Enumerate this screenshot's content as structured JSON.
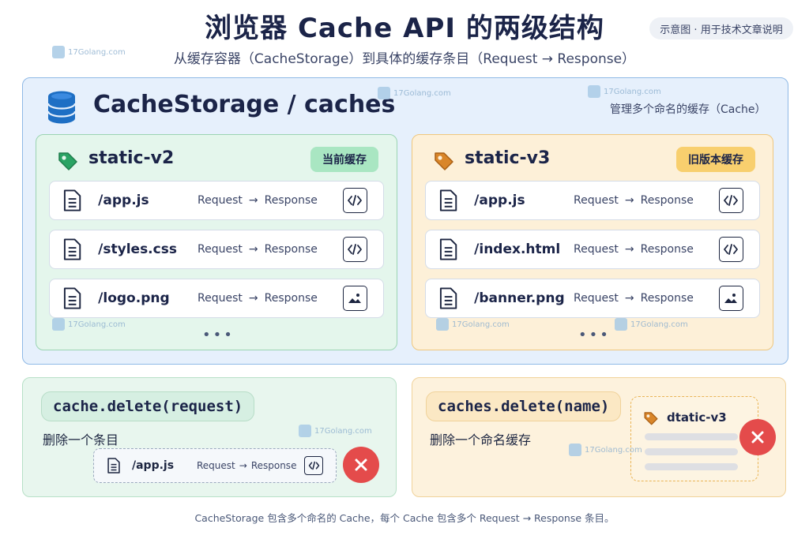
{
  "header": {
    "title": "浏览器 Cache API 的两级结构",
    "subtitle": "从缓存容器（CacheStorage）到具体的缓存条目（Request → Response）",
    "tag": "示意图 · 用于技术文章说明"
  },
  "watermark": "17Golang.com",
  "storage": {
    "title": "CacheStorage / caches",
    "note": "管理多个命名的缓存（Cache）"
  },
  "caches": [
    {
      "name": "static-v2",
      "badge": "当前缓存",
      "tag_color": "#2aa364",
      "entries": [
        {
          "path": "/app.js",
          "request": "Request",
          "arrow": "→",
          "response": "Response",
          "icon": "code-icon"
        },
        {
          "path": "/styles.css",
          "request": "Request",
          "arrow": "→",
          "response": "Response",
          "icon": "code-icon"
        },
        {
          "path": "/logo.png",
          "request": "Request",
          "arrow": "→",
          "response": "Response",
          "icon": "image-icon"
        }
      ],
      "more": "•••"
    },
    {
      "name": "static-v3",
      "badge": "旧版本缓存",
      "tag_color": "#d9862a",
      "entries": [
        {
          "path": "/app.js",
          "request": "Request",
          "arrow": "→",
          "response": "Response",
          "icon": "code-icon"
        },
        {
          "path": "/index.html",
          "request": "Request",
          "arrow": "→",
          "response": "Response",
          "icon": "code-icon"
        },
        {
          "path": "/banner.png",
          "request": "Request",
          "arrow": "→",
          "response": "Response",
          "icon": "image-icon"
        }
      ],
      "more": "•••"
    }
  ],
  "delete_entry": {
    "code": "cache.delete(request)",
    "desc": "删除一个条目",
    "entry": {
      "path": "/app.js",
      "request": "Request",
      "arrow": "→",
      "response": "Response"
    }
  },
  "delete_cache": {
    "code": "caches.delete(name)",
    "desc": "删除一个命名缓存",
    "card_name": "dtatic-v3"
  },
  "footer": "CacheStorage 包含多个命名的 Cache，每个 Cache 包含多个 Request → Response 条目。",
  "colors": {
    "storage_bg": "#e6f0fc",
    "green_panel": "#e4f6ec",
    "orange_panel": "#fdf0d8",
    "delete_red": "#e44b4b",
    "db_blue": "#1e6fc4"
  }
}
